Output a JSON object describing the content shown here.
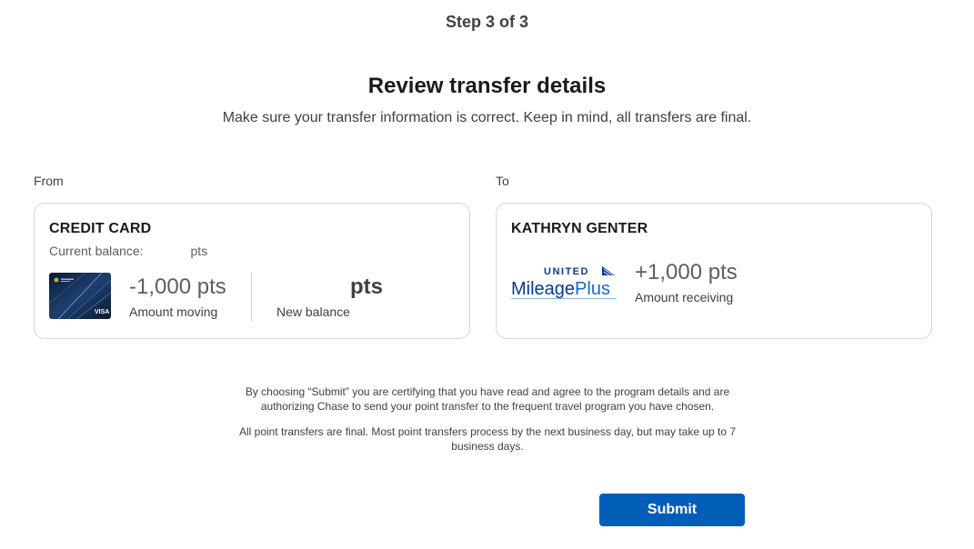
{
  "step": "Step 3 of 3",
  "title": "Review transfer details",
  "subtitle": "Make sure your transfer information is correct. Keep in mind, all transfers are final.",
  "from": {
    "label": "From",
    "card_title": "CREDIT CARD",
    "current_balance_label": "Current balance:",
    "current_balance_unit": "pts",
    "amount_moving_value": "-1,000 pts",
    "amount_moving_caption": "Amount moving",
    "new_balance_value": "pts",
    "new_balance_caption": "New balance",
    "card_brand": "VISA"
  },
  "to": {
    "label": "To",
    "card_title": "KATHRYN GENTER",
    "logo_top": "UNITED",
    "logo_bottom_a": "Mileage",
    "logo_bottom_b": "Plus",
    "amount_receiving_value": "+1,000 pts",
    "amount_receiving_caption": "Amount receiving"
  },
  "disclaimer": {
    "line1": "By choosing “Submit” you are certifying that you have read and agree to the program details and are authorizing Chase to send your point transfer to the frequent travel program you have chosen.",
    "line2": "All point transfers are final. Most point transfers process by the next business day, but may take up to 7 business days."
  },
  "submit_label": "Submit",
  "colors": {
    "primary_button": "#005eb8",
    "card_border": "#d3d6da",
    "united_blue": "#0a3b8c",
    "mileageplus_blue": "#0f6bd1"
  }
}
